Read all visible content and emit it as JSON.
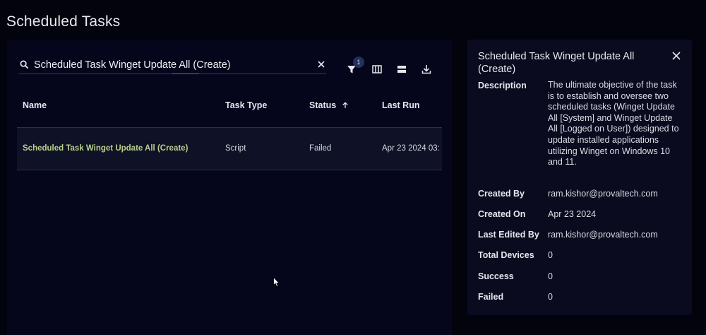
{
  "page": {
    "title": "Scheduled Tasks"
  },
  "search": {
    "value": "Scheduled Task Winget Update All (Create)"
  },
  "toolbar": {
    "filter_count": "1"
  },
  "table": {
    "columns": [
      "Name",
      "Task Type",
      "Status",
      "Last Run"
    ],
    "rows": [
      {
        "name": "Scheduled Task Winget Update All (Create)",
        "task_type": "Script",
        "status": "Failed",
        "last_run": "Apr 23 2024 03:"
      }
    ]
  },
  "detail": {
    "title": "Scheduled Task Winget Update All (Create)",
    "fields": [
      {
        "label": "Description",
        "value": "The ultimate objective of the task is to establish and oversee two scheduled tasks (Winget Update All [System] and Winget Update All [Logged on User]) designed to update installed applications utilizing Winget on Windows 10 and 11."
      },
      {
        "label": "Created By",
        "value": "ram.kishor@provaltech.com"
      },
      {
        "label": "Created On",
        "value": "Apr 23 2024"
      },
      {
        "label": "Last Edited By",
        "value": "ram.kishor@provaltech.com"
      },
      {
        "label": "Total Devices",
        "value": "0"
      },
      {
        "label": "Success",
        "value": "0"
      },
      {
        "label": "Failed",
        "value": "0"
      }
    ]
  },
  "icons": [
    "search-icon",
    "clear-icon",
    "filter-icon",
    "columns-icon",
    "density-icon",
    "download-icon",
    "sort-up-icon",
    "close-icon",
    "mouse-cursor-icon"
  ]
}
